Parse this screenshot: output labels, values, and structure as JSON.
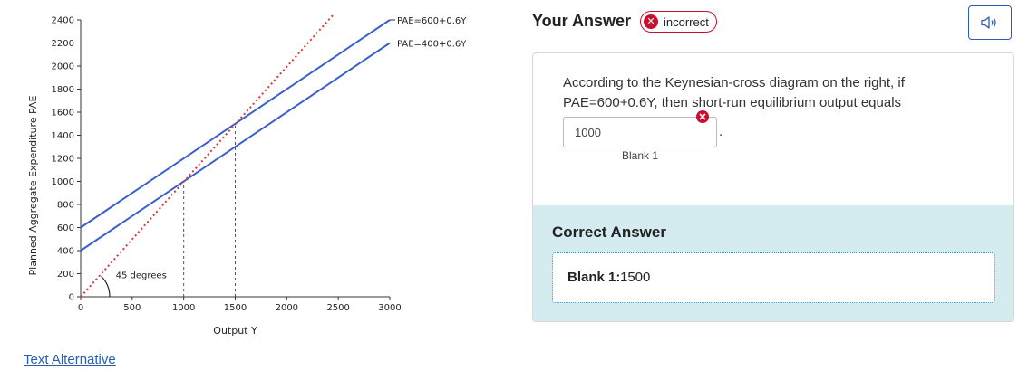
{
  "chart_data": {
    "type": "line",
    "xlabel": "Output Y",
    "ylabel": "Planned Aggregate Expenditure PAE",
    "xlim": [
      0,
      3000
    ],
    "ylim": [
      0,
      2400
    ],
    "x_ticks": [
      0,
      500,
      1000,
      1500,
      2000,
      2500,
      3000
    ],
    "y_ticks": [
      0,
      200,
      400,
      600,
      800,
      1000,
      1200,
      1400,
      1600,
      1800,
      2000,
      2200,
      2400
    ],
    "series": [
      {
        "name": "PAE=600+0.6Y",
        "intercept": 600,
        "slope": 0.6,
        "x": [
          0,
          3000
        ],
        "y": [
          600,
          2400
        ],
        "color": "#3a5fcd",
        "style": "solid"
      },
      {
        "name": "PAE=400+0.6Y",
        "intercept": 400,
        "slope": 0.6,
        "x": [
          0,
          3000
        ],
        "y": [
          400,
          2200
        ],
        "color": "#3a5fcd",
        "style": "solid"
      },
      {
        "name": "",
        "intercept": 0,
        "slope": 1,
        "x": [
          0,
          2400
        ],
        "y": [
          0,
          2400
        ],
        "color": "#d83a3a",
        "style": "dotted"
      }
    ],
    "reference_lines": [
      {
        "x": 1000,
        "y_top": 1000,
        "style": "dashed",
        "color": "#555555"
      },
      {
        "x": 1500,
        "y_top": 1500,
        "style": "dashed",
        "color": "#555555"
      }
    ],
    "annotations": [
      {
        "text": "45 degrees",
        "x": 340,
        "y": 160
      }
    ]
  },
  "links": {
    "text_alternative": "Text Alternative"
  },
  "answer": {
    "title": "Your Answer",
    "status": "incorrect",
    "status_color": "#c8102e",
    "question": "According to the Keynesian-cross diagram on the right, if PAE=600+0.6Y, then short-run equilibrium output equals",
    "input_value": "1000",
    "input_period": ".",
    "blank_label": "Blank 1",
    "audio_icon": "speaker-icon"
  },
  "correct": {
    "title": "Correct Answer",
    "blank_label": "Blank 1:",
    "blank_value": "1500",
    "background": "#d4ebf0"
  }
}
